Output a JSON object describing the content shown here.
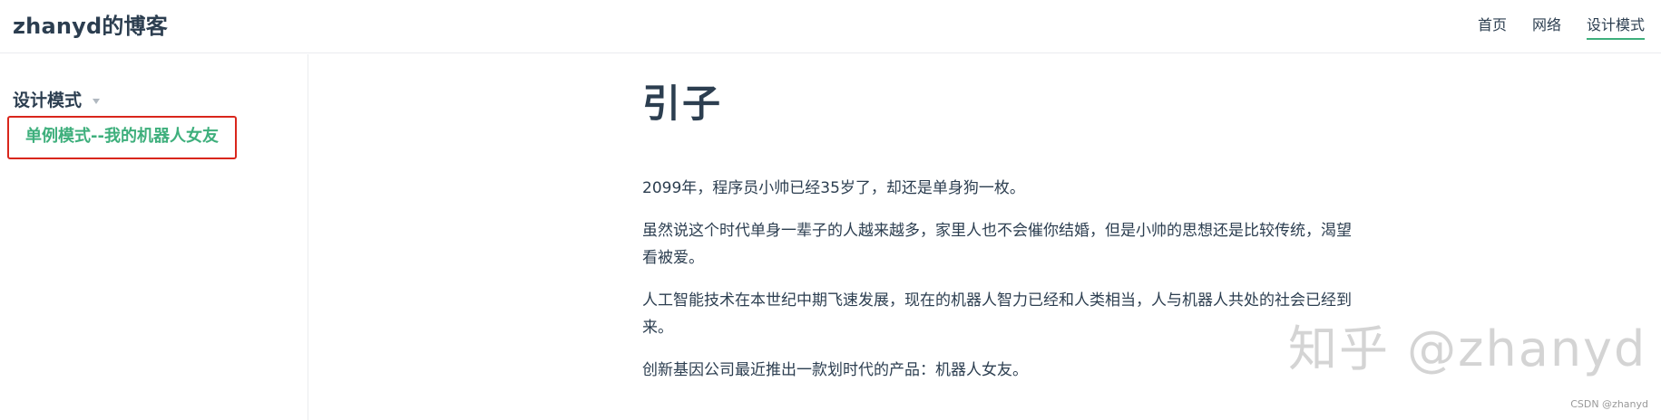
{
  "header": {
    "site_name": "zhanyd的博客",
    "nav": [
      {
        "label": "首页"
      },
      {
        "label": "网络"
      },
      {
        "label": "设计模式"
      }
    ]
  },
  "sidebar": {
    "heading": "设计模式",
    "items": [
      {
        "label": "单例模式--我的机器人女友"
      }
    ]
  },
  "article": {
    "title": "引子",
    "paragraphs": [
      "2099年，程序员小帅已经35岁了，却还是单身狗一枚。",
      "虽然说这个时代单身一辈子的人越来越多，家里人也不会催你结婚，但是小帅的思想还是比较传统，渴望",
      "看被爱。",
      "人工智能技术在本世纪中期飞速发展，现在的机器人智力已经和人类相当，人与机器人共处的社会已经到",
      "来。",
      "创新基因公司最近推出一款划时代的产品：机器人女友。"
    ]
  },
  "watermark": "知乎 @zhanyd",
  "csdn_mark": "CSDN @zhanyd",
  "colors": {
    "accent": "#3eaf7c",
    "text": "#2c3e50",
    "highlight_box": "#d9261c"
  }
}
